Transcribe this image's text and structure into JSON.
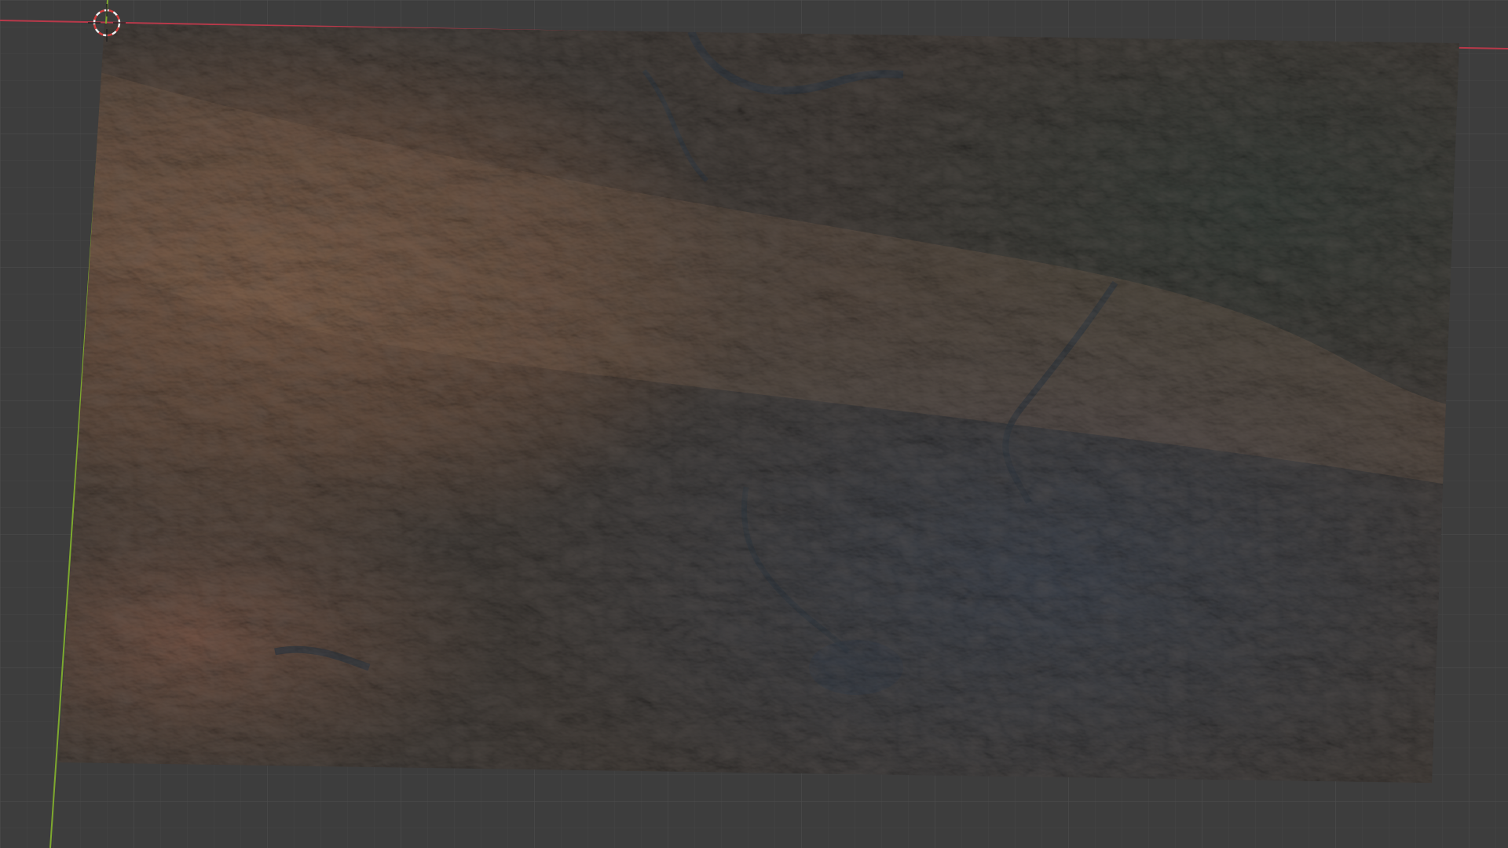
{
  "viewport": {
    "background_color": "#3d3d3d",
    "grid_minor_color": "#464646",
    "grid_major_color": "#4d4d4d",
    "x_axis_color": "#c8394a",
    "y_axis_color": "#7ea92e"
  },
  "terrain": {
    "description_icon": "terrain-plane",
    "palette": {
      "desert_brown": "#6a4f3e",
      "ridge_tan": "#8a6a52",
      "forest_dark": "#333a35",
      "valley_blue_gray": "#3c424c",
      "water_dark": "#2f3740"
    }
  },
  "cursor_3d": {
    "icon": "3d-cursor-icon",
    "color_red": "#d23c3c",
    "color_white": "#f0f0f0"
  }
}
